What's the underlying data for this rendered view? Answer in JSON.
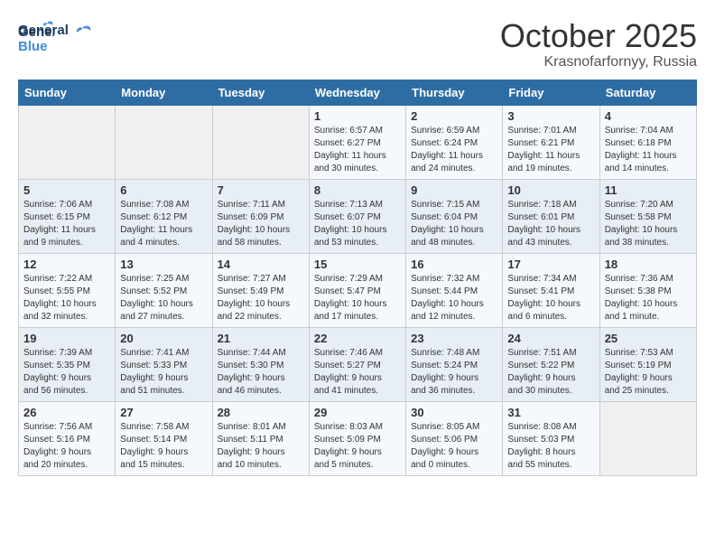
{
  "logo": {
    "line1": "General",
    "line2": "Blue"
  },
  "title": "October 2025",
  "subtitle": "Krasnofarfornyy, Russia",
  "weekdays": [
    "Sunday",
    "Monday",
    "Tuesday",
    "Wednesday",
    "Thursday",
    "Friday",
    "Saturday"
  ],
  "weeks": [
    [
      {
        "day": "",
        "info": ""
      },
      {
        "day": "",
        "info": ""
      },
      {
        "day": "",
        "info": ""
      },
      {
        "day": "1",
        "info": "Sunrise: 6:57 AM\nSunset: 6:27 PM\nDaylight: 11 hours\nand 30 minutes."
      },
      {
        "day": "2",
        "info": "Sunrise: 6:59 AM\nSunset: 6:24 PM\nDaylight: 11 hours\nand 24 minutes."
      },
      {
        "day": "3",
        "info": "Sunrise: 7:01 AM\nSunset: 6:21 PM\nDaylight: 11 hours\nand 19 minutes."
      },
      {
        "day": "4",
        "info": "Sunrise: 7:04 AM\nSunset: 6:18 PM\nDaylight: 11 hours\nand 14 minutes."
      }
    ],
    [
      {
        "day": "5",
        "info": "Sunrise: 7:06 AM\nSunset: 6:15 PM\nDaylight: 11 hours\nand 9 minutes."
      },
      {
        "day": "6",
        "info": "Sunrise: 7:08 AM\nSunset: 6:12 PM\nDaylight: 11 hours\nand 4 minutes."
      },
      {
        "day": "7",
        "info": "Sunrise: 7:11 AM\nSunset: 6:09 PM\nDaylight: 10 hours\nand 58 minutes."
      },
      {
        "day": "8",
        "info": "Sunrise: 7:13 AM\nSunset: 6:07 PM\nDaylight: 10 hours\nand 53 minutes."
      },
      {
        "day": "9",
        "info": "Sunrise: 7:15 AM\nSunset: 6:04 PM\nDaylight: 10 hours\nand 48 minutes."
      },
      {
        "day": "10",
        "info": "Sunrise: 7:18 AM\nSunset: 6:01 PM\nDaylight: 10 hours\nand 43 minutes."
      },
      {
        "day": "11",
        "info": "Sunrise: 7:20 AM\nSunset: 5:58 PM\nDaylight: 10 hours\nand 38 minutes."
      }
    ],
    [
      {
        "day": "12",
        "info": "Sunrise: 7:22 AM\nSunset: 5:55 PM\nDaylight: 10 hours\nand 32 minutes."
      },
      {
        "day": "13",
        "info": "Sunrise: 7:25 AM\nSunset: 5:52 PM\nDaylight: 10 hours\nand 27 minutes."
      },
      {
        "day": "14",
        "info": "Sunrise: 7:27 AM\nSunset: 5:49 PM\nDaylight: 10 hours\nand 22 minutes."
      },
      {
        "day": "15",
        "info": "Sunrise: 7:29 AM\nSunset: 5:47 PM\nDaylight: 10 hours\nand 17 minutes."
      },
      {
        "day": "16",
        "info": "Sunrise: 7:32 AM\nSunset: 5:44 PM\nDaylight: 10 hours\nand 12 minutes."
      },
      {
        "day": "17",
        "info": "Sunrise: 7:34 AM\nSunset: 5:41 PM\nDaylight: 10 hours\nand 6 minutes."
      },
      {
        "day": "18",
        "info": "Sunrise: 7:36 AM\nSunset: 5:38 PM\nDaylight: 10 hours\nand 1 minute."
      }
    ],
    [
      {
        "day": "19",
        "info": "Sunrise: 7:39 AM\nSunset: 5:35 PM\nDaylight: 9 hours\nand 56 minutes."
      },
      {
        "day": "20",
        "info": "Sunrise: 7:41 AM\nSunset: 5:33 PM\nDaylight: 9 hours\nand 51 minutes."
      },
      {
        "day": "21",
        "info": "Sunrise: 7:44 AM\nSunset: 5:30 PM\nDaylight: 9 hours\nand 46 minutes."
      },
      {
        "day": "22",
        "info": "Sunrise: 7:46 AM\nSunset: 5:27 PM\nDaylight: 9 hours\nand 41 minutes."
      },
      {
        "day": "23",
        "info": "Sunrise: 7:48 AM\nSunset: 5:24 PM\nDaylight: 9 hours\nand 36 minutes."
      },
      {
        "day": "24",
        "info": "Sunrise: 7:51 AM\nSunset: 5:22 PM\nDaylight: 9 hours\nand 30 minutes."
      },
      {
        "day": "25",
        "info": "Sunrise: 7:53 AM\nSunset: 5:19 PM\nDaylight: 9 hours\nand 25 minutes."
      }
    ],
    [
      {
        "day": "26",
        "info": "Sunrise: 7:56 AM\nSunset: 5:16 PM\nDaylight: 9 hours\nand 20 minutes."
      },
      {
        "day": "27",
        "info": "Sunrise: 7:58 AM\nSunset: 5:14 PM\nDaylight: 9 hours\nand 15 minutes."
      },
      {
        "day": "28",
        "info": "Sunrise: 8:01 AM\nSunset: 5:11 PM\nDaylight: 9 hours\nand 10 minutes."
      },
      {
        "day": "29",
        "info": "Sunrise: 8:03 AM\nSunset: 5:09 PM\nDaylight: 9 hours\nand 5 minutes."
      },
      {
        "day": "30",
        "info": "Sunrise: 8:05 AM\nSunset: 5:06 PM\nDaylight: 9 hours\nand 0 minutes."
      },
      {
        "day": "31",
        "info": "Sunrise: 8:08 AM\nSunset: 5:03 PM\nDaylight: 8 hours\nand 55 minutes."
      },
      {
        "day": "",
        "info": ""
      }
    ]
  ]
}
